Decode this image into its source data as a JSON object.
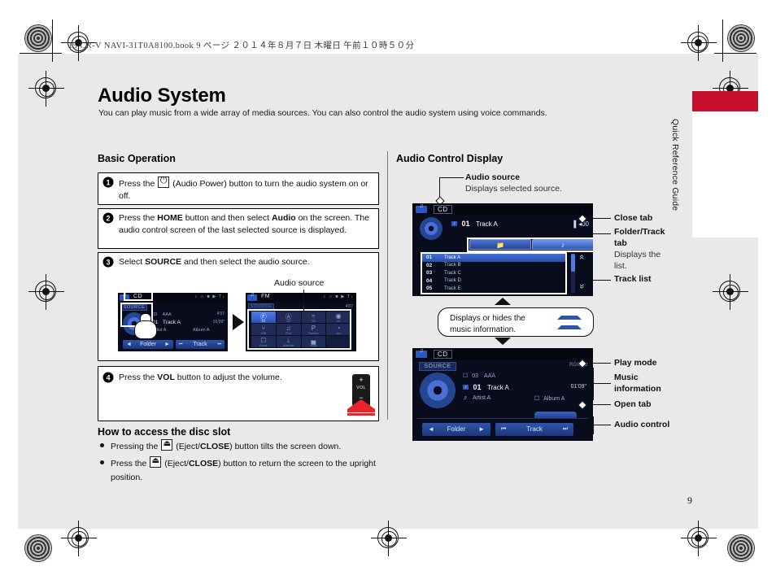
{
  "print_header": "15 CR-V NAVI-31T0A8100.book   9 ページ   ２０１４年８月７日   木曜日   午前１０時５０分",
  "page_number": "9",
  "side_tab": {
    "label": "Quick Reference Guide",
    "color": "#c8102e"
  },
  "title": "Audio System",
  "subtitle": "You can play music from a wide array of media sources. You can also control the audio system using voice commands.",
  "left_column": {
    "heading": "Basic Operation",
    "steps": [
      {
        "num": "❶",
        "html": "Press the <span class=\"ic-inline ic-power\"></span> (Audio Power) button to turn the audio system on or off."
      },
      {
        "num": "❷",
        "html": "Press the <b>HOME</b> button and then select <b>Audio</b> on the screen. The audio control screen of the last selected source is displayed."
      },
      {
        "num": "❸",
        "html": "Select <b>SOURCE</b> and then select the audio source."
      },
      {
        "num": "❹",
        "html": "Press the <b>VOL</b> button to adjust the volume."
      }
    ],
    "step3_callout": "Audio source",
    "disc_slot": {
      "heading": "How to access the disc slot",
      "bullets": [
        "Pressing the <span class=\"ic-inline ic-eject\"></span> (Eject/<b>CLOSE</b>) button tilts the screen down.",
        "Press the <span class=\"ic-inline ic-eject\"></span> (Eject/<b>CLOSE</b>) button to return the screen to the upright position."
      ]
    },
    "vol_button": {
      "plus": "+",
      "minus": "−",
      "label": "VOL"
    }
  },
  "right_column": {
    "heading": "Audio Control Display",
    "callouts": {
      "audio_source": {
        "label": "Audio source",
        "desc": "Displays selected source."
      },
      "close_tab": "Close tab",
      "folder_track_tab": {
        "label": "Folder/Track tab",
        "desc": "Displays the list."
      },
      "track_list": "Track list",
      "play_mode": "Play mode",
      "music_information": "Music information",
      "open_tab": "Open tab",
      "audio_control": "Audio control"
    },
    "balloon": "Displays or hides the music information."
  },
  "screens": {
    "cd_source_select": {
      "source": "CD",
      "source_button": "SOURCE",
      "status_right": "♪ ☼ ■ ▶ T↓",
      "time_right": "4'07",
      "elapsed": "01'09\"",
      "rows": [
        {
          "icon": "folder",
          "num": "03",
          "text": "AAA"
        },
        {
          "icon": "track",
          "num": "01",
          "text": "Track A"
        }
      ],
      "artist": "Artist A",
      "album": "Album A",
      "controls": [
        {
          "prev": "◄",
          "label": "Folder",
          "next": "►"
        },
        {
          "prev": "⏮",
          "label": "Track",
          "next": "⏭"
        }
      ]
    },
    "source_grid": {
      "source": "FM",
      "source_button": "SOURCE",
      "time_right": "4'07",
      "items": [
        {
          "name": "FM",
          "selected": true
        },
        {
          "name": "AM",
          "selected": false
        },
        {
          "name": "XM",
          "selected": false
        },
        {
          "name": "CD",
          "selected": false
        },
        {
          "name": "USB",
          "selected": false
        },
        {
          "name": "iPod",
          "selected": false
        },
        {
          "name": "Pandora",
          "selected": false
        },
        {
          "name": "aha",
          "selected": false
        },
        {
          "name": "Phone",
          "selected": false
        },
        {
          "name": "Bluetooth",
          "selected": false
        },
        {
          "name": "HDMI",
          "selected": false
        }
      ]
    },
    "track_list_screen": {
      "source": "CD",
      "now_playing_num": "01",
      "now_playing": "Track A",
      "volume_value": "00",
      "tabs": [
        {
          "icon": "folder"
        },
        {
          "icon": "note",
          "selected": true
        }
      ],
      "tracks": [
        {
          "num": "01",
          "title": "Track A",
          "selected": true
        },
        {
          "num": "02",
          "title": "Track B",
          "selected": false
        },
        {
          "num": "03",
          "title": "Track C",
          "selected": false
        },
        {
          "num": "04",
          "title": "Track D",
          "selected": false
        },
        {
          "num": "05",
          "title": "Track E",
          "selected": false
        }
      ],
      "scroll_up": "«",
      "scroll_down": "»"
    },
    "music_info_screen": {
      "source": "CD",
      "source_button": "SOURCE",
      "play_mode": "RDM ⇄",
      "folder_num": "03",
      "folder_name": "AAA",
      "track_num": "01",
      "track_name": "Track A",
      "artist": "Artist A",
      "album": "Album A",
      "elapsed": "01'09\"",
      "controls": [
        {
          "prev": "◄",
          "label": "Folder",
          "next": "►"
        },
        {
          "prev": "⏮",
          "label": "Track",
          "next": "⏭"
        }
      ]
    }
  }
}
